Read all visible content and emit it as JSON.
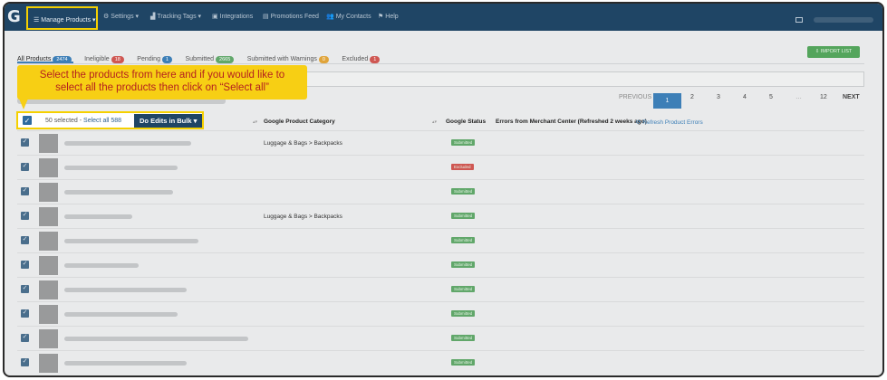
{
  "nav": {
    "logo": "G",
    "items": [
      {
        "label": "Manage Products ▾",
        "icon": "list-icon"
      },
      {
        "label": "Settings ▾",
        "icon": "gear-icon"
      },
      {
        "label": "Tracking Tags ▾",
        "icon": "chart-icon"
      },
      {
        "label": "Integrations",
        "icon": "briefcase-icon"
      },
      {
        "label": "Promotions Feed",
        "icon": "document-icon"
      },
      {
        "label": "My Contacts",
        "icon": "users-icon"
      },
      {
        "label": "Help",
        "icon": "flag-icon"
      }
    ]
  },
  "tabs": [
    {
      "label": "All Products",
      "count": "2474",
      "color": "#3d7fb7"
    },
    {
      "label": "Ineligible",
      "count": "18",
      "color": "#cf5752"
    },
    {
      "label": "Pending",
      "count": "1",
      "color": "#3d7fb7"
    },
    {
      "label": "Submitted",
      "count": "2665",
      "color": "#61a76a"
    },
    {
      "label": "Submitted with Warnings",
      "count": "0",
      "color": "#e0a43a"
    },
    {
      "label": "Excluded",
      "count": "1",
      "color": "#cf5752"
    }
  ],
  "import_label": "⇩ IMPORT LIST",
  "pagination": {
    "previous": "PREVIOUS",
    "pages": [
      "1",
      "2",
      "3",
      "4",
      "5",
      "…",
      "12"
    ],
    "next": "NEXT"
  },
  "table": {
    "columns": {
      "category": "Google Product Category",
      "status": "Google Status",
      "errors": "Errors from Merchant Center (Refreshed 2 weeks ago)",
      "refresh": "⟳ Refresh Product Errors"
    },
    "rows": [
      {
        "category": "Luggage & Bags > Backpacks",
        "status": "Submitted"
      },
      {
        "category": "",
        "status": "Excluded"
      },
      {
        "category": "",
        "status": "Submitted"
      },
      {
        "category": "Luggage & Bags > Backpacks",
        "status": "Submitted"
      },
      {
        "category": "",
        "status": "Submitted"
      },
      {
        "category": "",
        "status": "Submitted"
      },
      {
        "category": "",
        "status": "Submitted"
      },
      {
        "category": "",
        "status": "Submitted"
      },
      {
        "category": "",
        "status": "Submitted"
      },
      {
        "category": "",
        "status": "Submitted"
      }
    ]
  },
  "bulk": {
    "selected_text": "50 selected -",
    "select_all": "Select all 588",
    "button": "Do Edits in Bulk ▾"
  },
  "callout": {
    "line1": "Select the products from here and if you would like to",
    "line2": "select all the products then click on “Select all”"
  }
}
